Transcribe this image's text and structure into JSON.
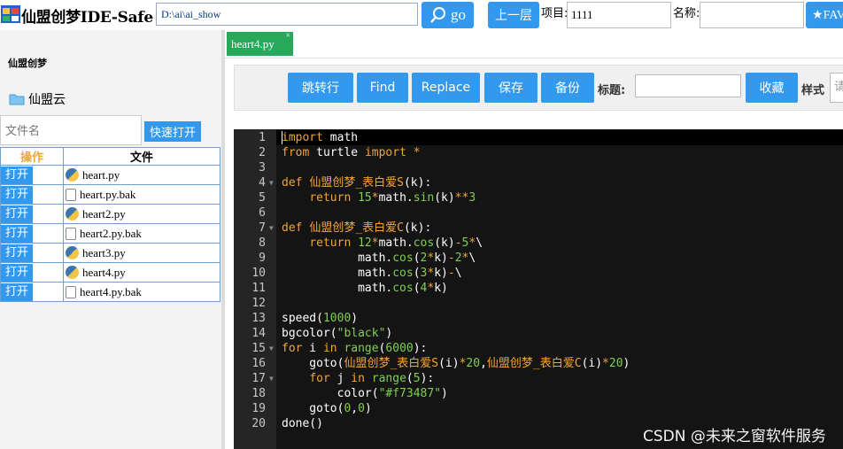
{
  "header": {
    "app_title": "仙盟创梦IDE-Safe",
    "path_value": "D:\\ai\\ai_show",
    "go_label": "go",
    "up_label": "上一层",
    "project_label": "项目:",
    "project_value": "1111",
    "name_label": "名称:",
    "name_value": "",
    "fav_label": "★FAV"
  },
  "sidebar": {
    "brand": "仙盟创梦",
    "cloud_label": "仙盟云",
    "filename_placeholder": "文件名",
    "quick_open_label": "快速打开",
    "table_headers": {
      "op": "操作",
      "file": "文件"
    },
    "open_label": "打开",
    "files": [
      {
        "name": "heart.py",
        "type": "py"
      },
      {
        "name": "heart.py.bak",
        "type": "bak"
      },
      {
        "name": "heart2.py",
        "type": "py"
      },
      {
        "name": "heart2.py.bak",
        "type": "bak"
      },
      {
        "name": "heart3.py",
        "type": "py"
      },
      {
        "name": "heart4.py",
        "type": "py"
      },
      {
        "name": "heart4.py.bak",
        "type": "bak"
      }
    ]
  },
  "tabs": [
    {
      "label": "heart4.py",
      "close": "×"
    }
  ],
  "toolbar": {
    "goto_label": "跳转行",
    "find_label": "Find",
    "replace_label": "Replace",
    "save_label": "保存",
    "backup_label": "备份",
    "title_label": "标题:",
    "title_value": "",
    "collect_label": "收藏",
    "style_label": "样式",
    "style_value": "请"
  },
  "editor": {
    "lines": [
      "import math",
      "from turtle import *",
      "",
      "def 仙盟创梦_表白爱S(k):",
      "    return 15*math.sin(k)**3",
      "",
      "def 仙盟创梦_表白爱C(k):",
      "    return 12*math.cos(k)-5*\\",
      "           math.cos(2*k)-2*\\",
      "           math.cos(3*k)-\\",
      "           math.cos(4*k)",
      "",
      "speed(1000)",
      "bgcolor(\"black\")",
      "for i in range(6000):",
      "    goto(仙盟创梦_表白爱S(i)*20,仙盟创梦_表白爱C(i)*20)",
      "    for j in range(5):",
      "        color(\"#f73487\")",
      "    goto(0,0)",
      "done()"
    ],
    "fold_lines": [
      4,
      7,
      15,
      17
    ]
  },
  "watermark": "CSDN @未来之窗软件服务",
  "colors": {
    "accent": "#3399ee",
    "tab_active": "#27a85b",
    "editor_bg": "#141414",
    "keyword": "#f0a533",
    "builtin": "#7fcf52"
  }
}
